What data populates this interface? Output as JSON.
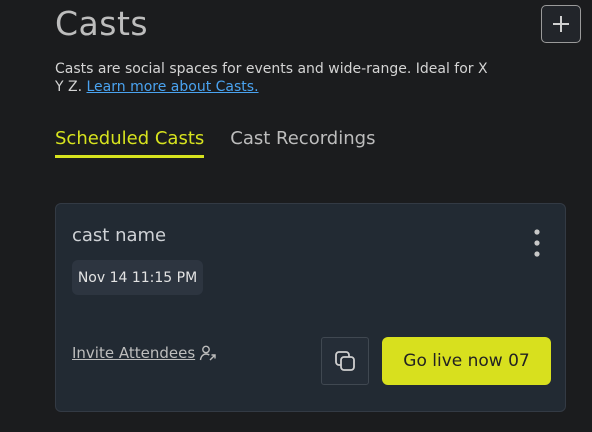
{
  "header": {
    "title": "Casts",
    "add_icon": "plus-icon"
  },
  "description": {
    "text": "Casts are social spaces for events and wide-range. Ideal for X Y Z. ",
    "link_text": "Learn more about Casts."
  },
  "tabs": [
    {
      "label": "Scheduled Casts",
      "active": true
    },
    {
      "label": "Cast Recordings",
      "active": false
    }
  ],
  "card": {
    "name": "cast name",
    "date": "Nov 14 11:15 PM",
    "invite_label": "Invite Attendees",
    "invite_icon": "user-share-icon",
    "copy_icon": "copy-icon",
    "more_icon": "vertical-dots-icon",
    "go_live_label": "Go live now 07"
  },
  "colors": {
    "accent": "#d7e31e",
    "link": "#4aa3f0",
    "background": "#1b1c1e",
    "card": "#222a33"
  }
}
